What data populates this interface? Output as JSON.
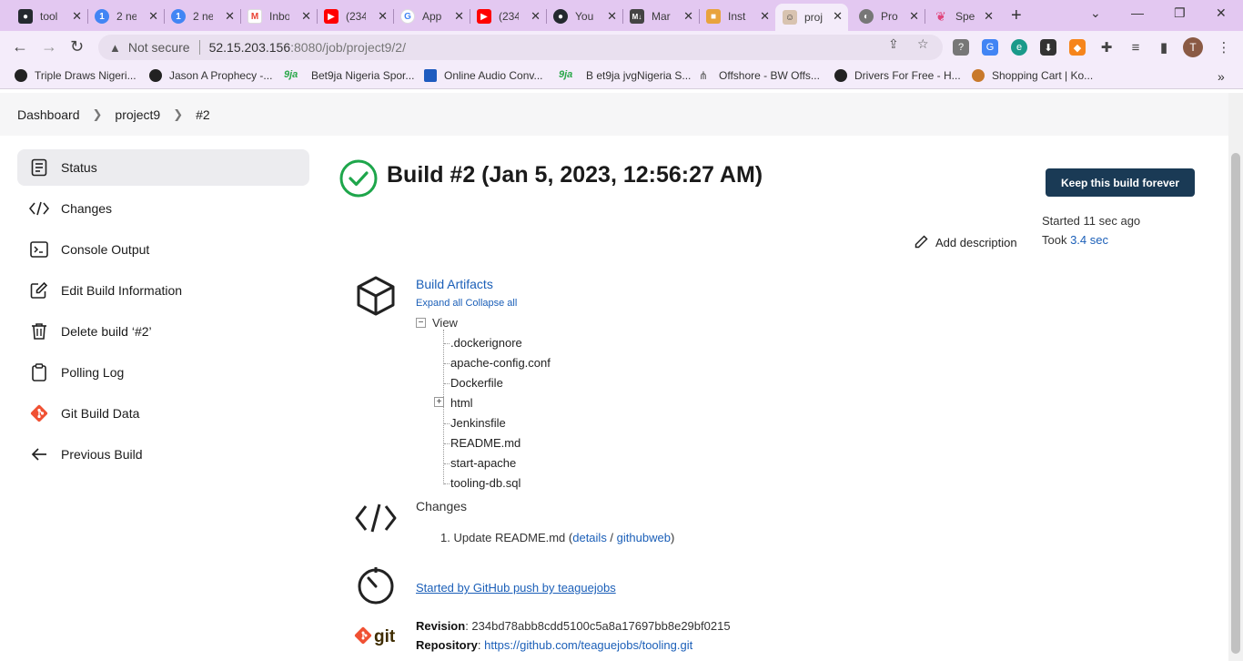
{
  "browser": {
    "tabs": [
      {
        "label": "tool",
        "icon": "github-icon",
        "color": "#24292f"
      },
      {
        "label": "2 ne",
        "icon": "google-one-icon",
        "color": "#4285f4"
      },
      {
        "label": "2 ne",
        "icon": "google-one-icon",
        "color": "#4285f4"
      },
      {
        "label": "Inbo",
        "icon": "gmail-icon",
        "color": "#ea4335"
      },
      {
        "label": "(234",
        "icon": "youtube-icon",
        "color": "#ff0000"
      },
      {
        "label": "App",
        "icon": "google-icon",
        "color": "#4285f4"
      },
      {
        "label": "(234",
        "icon": "youtube-icon",
        "color": "#ff0000"
      },
      {
        "label": "You",
        "icon": "github-icon",
        "color": "#24292f"
      },
      {
        "label": "Mar",
        "icon": "markdown-icon",
        "color": "#444"
      },
      {
        "label": "Inst",
        "icon": "aws-box-icon",
        "color": "#e8a33d"
      },
      {
        "label": "proj",
        "icon": "jenkins-icon",
        "color": "#d33833"
      },
      {
        "label": "Pro",
        "icon": "globe-icon",
        "color": "#666"
      },
      {
        "label": "Spe",
        "icon": "feather-icon",
        "color": "#e0457b"
      }
    ],
    "url_host": "52.15.203.156",
    "url_rest": ":8080/job/project9/2/",
    "not_secure": "Not secure",
    "profile_initial": "T",
    "bookmarks": [
      {
        "label": "Triple Draws Nigeri...",
        "color": "#333"
      },
      {
        "label": "Jason A Prophecy -...",
        "color": "#333"
      },
      {
        "label": "Bet9ja Nigeria Spor...",
        "color": "#2ba84a"
      },
      {
        "label": "Online Audio Conv...",
        "color": "#1e5bbf"
      },
      {
        "label": "B et9ja jvgNigeria S...",
        "color": "#2ba84a"
      },
      {
        "label": "Offshore - BW Offs...",
        "color": "#555"
      },
      {
        "label": "Drivers For Free - H...",
        "color": "#333"
      },
      {
        "label": "Shopping Cart | Ko...",
        "color": "#c8792b"
      }
    ]
  },
  "breadcrumb": [
    "Dashboard",
    "project9",
    "#2"
  ],
  "sidebar": [
    {
      "label": "Status",
      "icon": "status-icon"
    },
    {
      "label": "Changes",
      "icon": "code-icon"
    },
    {
      "label": "Console Output",
      "icon": "terminal-icon"
    },
    {
      "label": "Edit Build Information",
      "icon": "edit-icon"
    },
    {
      "label": "Delete build ‘#2’",
      "icon": "trash-icon"
    },
    {
      "label": "Polling Log",
      "icon": "clipboard-icon"
    },
    {
      "label": "Git Build Data",
      "icon": "git-icon"
    },
    {
      "label": "Previous Build",
      "icon": "arrow-left-icon"
    }
  ],
  "build": {
    "title": "Build #2 (Jan 5, 2023, 12:56:27 AM)",
    "keep_label": "Keep this build forever",
    "started": "Started 11 sec ago",
    "took_prefix": "Took ",
    "took_value": "3.4 sec",
    "add_description": "Add description",
    "status_color": "#1ea64b"
  },
  "artifacts": {
    "title": "Build Artifacts",
    "expand_all": "Expand all",
    "collapse_all": "Collapse all",
    "root": "View",
    "files": [
      ".dockerignore",
      "apache-config.conf",
      "Dockerfile",
      "html",
      "Jenkinsfile",
      "README.md",
      "start-apache",
      "tooling-db.sql"
    ]
  },
  "changes": {
    "heading": "Changes",
    "item_num": "1.",
    "item_text": "Update README.md (",
    "details": "details",
    "slash": " / ",
    "githubweb": "githubweb",
    "close": ")"
  },
  "trigger": "Started by GitHub push by teaguejobs",
  "git": {
    "revision_label": "Revision",
    "revision": "234bd78abb8cdd5100c5a8a17697bb8e29bf0215",
    "repository_label": "Repository",
    "repository": "https://github.com/teaguejobs/tooling.git",
    "logo_text": "git"
  }
}
